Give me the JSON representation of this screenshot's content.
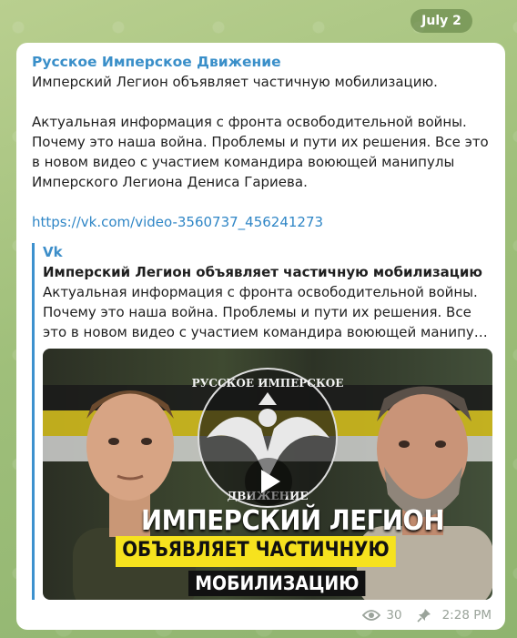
{
  "date_pill": "July 2",
  "message": {
    "channel_name": "Русское Имперское Движение",
    "text_lines": [
      "Имперский Легион объявляет частичную мобилизацию.",
      "",
      "Актуальная информация с фронта освободительной войны.",
      "Почему это наша война. Проблемы и пути их решения. Все это",
      "в новом видео с участием командира воюющей манипулы",
      "Имперского Легиона Дениса Гариева.",
      ""
    ],
    "link": "https://vk.com/video-3560737_456241273",
    "preview": {
      "site": "Vk",
      "title": "Имперский Легион объявляет частичную мобилизацию",
      "desc_lines": [
        "Актуальная информация с фронта освободительной войны.",
        "Почему это наша война. Проблемы и пути их решения. Все",
        "это в новом видео с участием командира воюющей манипул..."
      ],
      "thumbnail": {
        "emblem_text_top": "РУССКОЕ ИМПЕРСКОЕ",
        "emblem_text_bottom": "ДВИЖЕНИЕ",
        "caption_line1": "ИМПЕРСКИЙ ЛЕГИОН",
        "caption_line2": "ОБЪЯВЛЯЕТ ЧАСТИЧНУЮ",
        "caption_line3": "МОБИЛИЗАЦИЮ"
      }
    },
    "views": "30",
    "time": "2:28 PM",
    "icons": [
      "eye-icon",
      "pin-icon",
      "play-icon"
    ]
  },
  "colors": {
    "accent": "#3a8fc9",
    "preview_bar": "#3d91ce",
    "caption_yellow": "#f6e21e",
    "meta_gray": "#9aa39a"
  }
}
